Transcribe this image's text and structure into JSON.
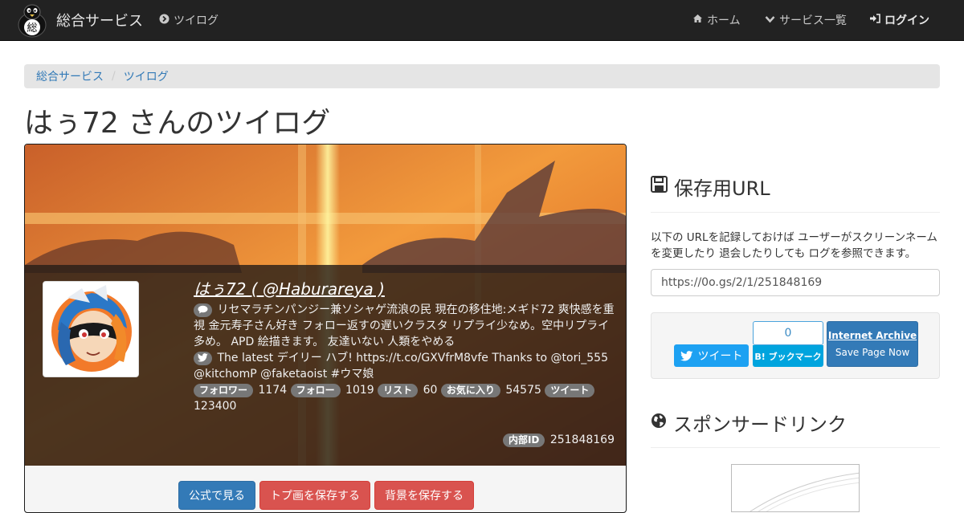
{
  "navbar": {
    "brand": "総合サービス",
    "logo_char": "総",
    "tweetlog_link": "ツイログ",
    "home": "ホーム",
    "services": "サービス一覧",
    "login": "ログイン"
  },
  "breadcrumb": [
    "総合サービス",
    "ツイログ"
  ],
  "page_title": "はぅ72 さんのツイログ",
  "profile": {
    "display_name": "はぅ72 ( @Haburareya )",
    "bio": "リセマラチンパンジー兼ソシャゲ流浪の民 現在の移住地:メギド72 爽快感を重視 金元寿子さん好き フォロー返すの遅いクラスタ リプライ少なめ。空中リプライ多め。 APD 絵描きます。 友達いない 人類をやめる",
    "latest_tweet": "The latest デイリー ハブ! https://t.co/GXVfrM8vfe Thanks to @tori_555 @kitchomP @faketaoist #ウマ娘",
    "stats": [
      {
        "label": "フォロワー",
        "value": "1174"
      },
      {
        "label": "フォロー",
        "value": "1019"
      },
      {
        "label": "リスト",
        "value": "60"
      },
      {
        "label": "お気に入り",
        "value": "54575"
      },
      {
        "label": "ツイート",
        "value": "123400"
      }
    ],
    "internal_id_label": "内部ID",
    "internal_id": "251848169"
  },
  "actions": {
    "official": "公式で見る",
    "save_icon": "トプ画を保存する",
    "save_bg": "背景を保存する"
  },
  "sidebar": {
    "save_url_heading": "保存用URL",
    "description": "以下の URLを記録しておけば ユーザーがスクリーンネームを変更したり 退会したりしても ログを参照できます。",
    "url": "https://0o.gs/2/1/251848169",
    "tweet_btn": "ツイート",
    "hatena_count": "0",
    "hatena_btn": "B! ブックマーク",
    "ia_title": "Internet Archive",
    "ia_sub": "Save Page Now",
    "sponsored_heading": "スポンサードリンク"
  },
  "colors": {
    "navbar_bg": "#222222",
    "primary": "#337ab7",
    "danger": "#d9534f",
    "twitter": "#1da1f2",
    "hatena": "#00a4de"
  }
}
